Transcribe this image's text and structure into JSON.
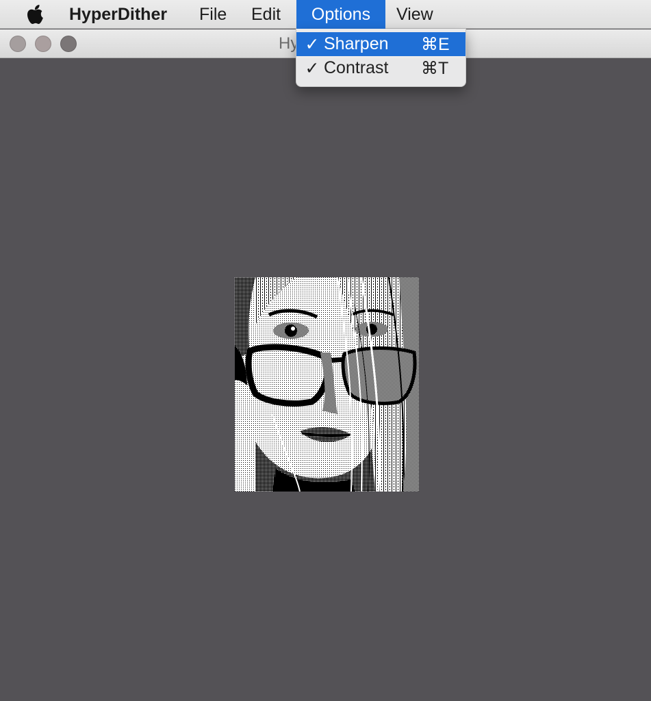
{
  "menubar": {
    "apple_icon": "apple-logo-icon",
    "app_name": "HyperDither",
    "items": [
      "File",
      "Edit",
      "Options",
      "View"
    ],
    "active_item": "Options"
  },
  "window": {
    "title": "Hy",
    "buttons": [
      "close",
      "minimize",
      "zoom"
    ]
  },
  "options_menu": {
    "items": [
      {
        "check": "✓",
        "label": "Sharpen",
        "shortcut": "⌘E",
        "highlighted": true
      },
      {
        "check": "✓",
        "label": "Contrast",
        "shortcut": "⌘T",
        "highlighted": false
      }
    ]
  },
  "image": {
    "description_icon": "dithered-portrait-image",
    "style": "1-bit dithered"
  },
  "colors": {
    "menu_highlight": "#1f6fd6",
    "window_background": "#545256",
    "menubar_background": "#e6e6e6"
  }
}
